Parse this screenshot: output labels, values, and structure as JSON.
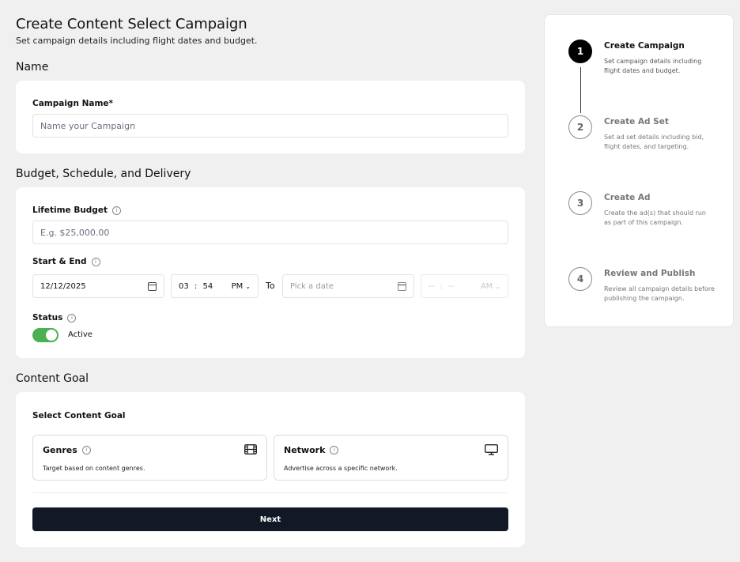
{
  "header": {
    "title": "Create Content Select Campaign",
    "subtitle": "Set campaign details including flight dates and budget."
  },
  "name_section": {
    "title": "Name",
    "campaign_name_label": "Campaign Name*",
    "campaign_name_placeholder": "Name your Campaign"
  },
  "budget_section": {
    "title": "Budget, Schedule, and Delivery",
    "lifetime_budget_label": "Lifetime Budget",
    "lifetime_budget_placeholder": "E.g. $25,000.00",
    "start_end_label": "Start & End",
    "start_date": "12/12/2025",
    "start_hour": "03",
    "start_minute": "54",
    "start_ampm": "PM",
    "time_separator": ":",
    "to_label": "To",
    "end_date_placeholder": "Pick a date",
    "end_hour": "--",
    "end_minute": "--",
    "end_ampm": "AM",
    "status_label": "Status",
    "status_value": "Active",
    "status_on": true
  },
  "content_goal": {
    "title": "Content Goal",
    "select_label": "Select Content Goal",
    "options": [
      {
        "title": "Genres",
        "desc": "Target based on content genres.",
        "icon": "film-icon"
      },
      {
        "title": "Network",
        "desc": "Advertise across a specific network.",
        "icon": "monitor-icon"
      }
    ],
    "next_label": "Next"
  },
  "steps": [
    {
      "number": "1",
      "title": "Create Campaign",
      "desc": "Set campaign details including flight dates and budget.",
      "active": true
    },
    {
      "number": "2",
      "title": "Create Ad Set",
      "desc": "Set ad set details including bid, flight dates, and targeting.",
      "active": false
    },
    {
      "number": "3",
      "title": "Create Ad",
      "desc": "Create the ad(s) that should run as part of this campaign.",
      "active": false
    },
    {
      "number": "4",
      "title": "Review and Publish",
      "desc": "Review all campaign details before publishing the campaign.",
      "active": false
    }
  ],
  "colors": {
    "toggle_on": "#4caf50",
    "primary_button": "#131826",
    "page_bg": "#f0f0f0"
  }
}
